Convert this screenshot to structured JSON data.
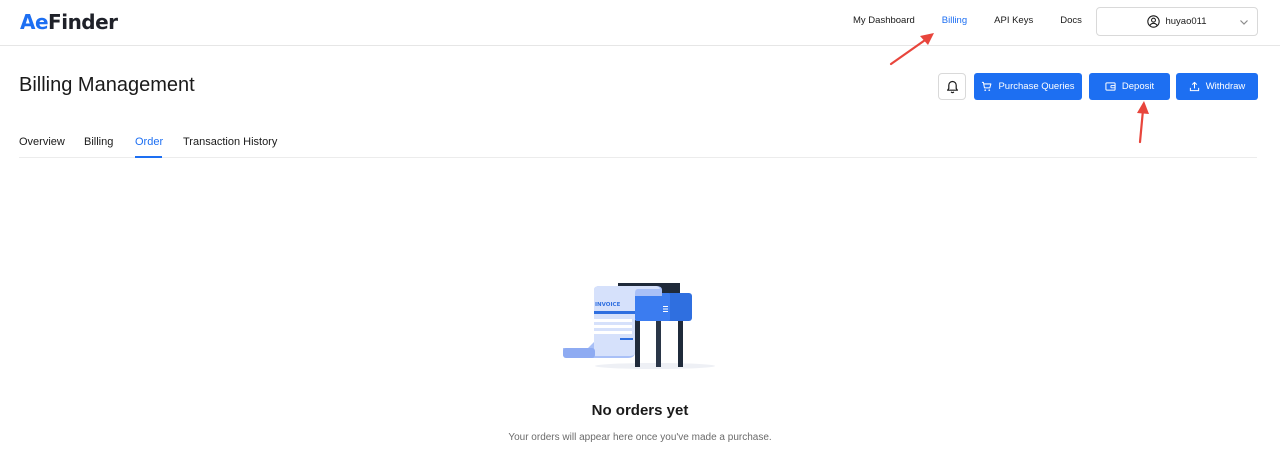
{
  "brand": {
    "logo_prefix": "Ae",
    "logo_suffix": "Finder",
    "accent": "#1d6ff2"
  },
  "nav": {
    "items": [
      {
        "label": "My Dashboard",
        "active": false
      },
      {
        "label": "Billing",
        "active": true
      },
      {
        "label": "API Keys",
        "active": false
      },
      {
        "label": "Docs",
        "active": false
      }
    ]
  },
  "user": {
    "name": "huyao011"
  },
  "page": {
    "title": "Billing Management"
  },
  "actions": {
    "purchase_label": "Purchase Queries",
    "deposit_label": "Deposit",
    "withdraw_label": "Withdraw"
  },
  "tabs": [
    {
      "label": "Overview",
      "active": false
    },
    {
      "label": "Billing",
      "active": false
    },
    {
      "label": "Order",
      "active": true
    },
    {
      "label": "Transaction History",
      "active": false
    }
  ],
  "empty_state": {
    "illustration_label": "INVOICE",
    "title": "No orders yet",
    "subtitle": "Your orders will appear here once you've made a purchase."
  },
  "icons": {
    "user": "user-circle-icon",
    "chevron": "chevron-down-icon",
    "bell": "bell-icon",
    "cart": "cart-icon",
    "wallet": "wallet-icon",
    "upload": "upload-icon"
  },
  "annotation_color": "#e8453c"
}
